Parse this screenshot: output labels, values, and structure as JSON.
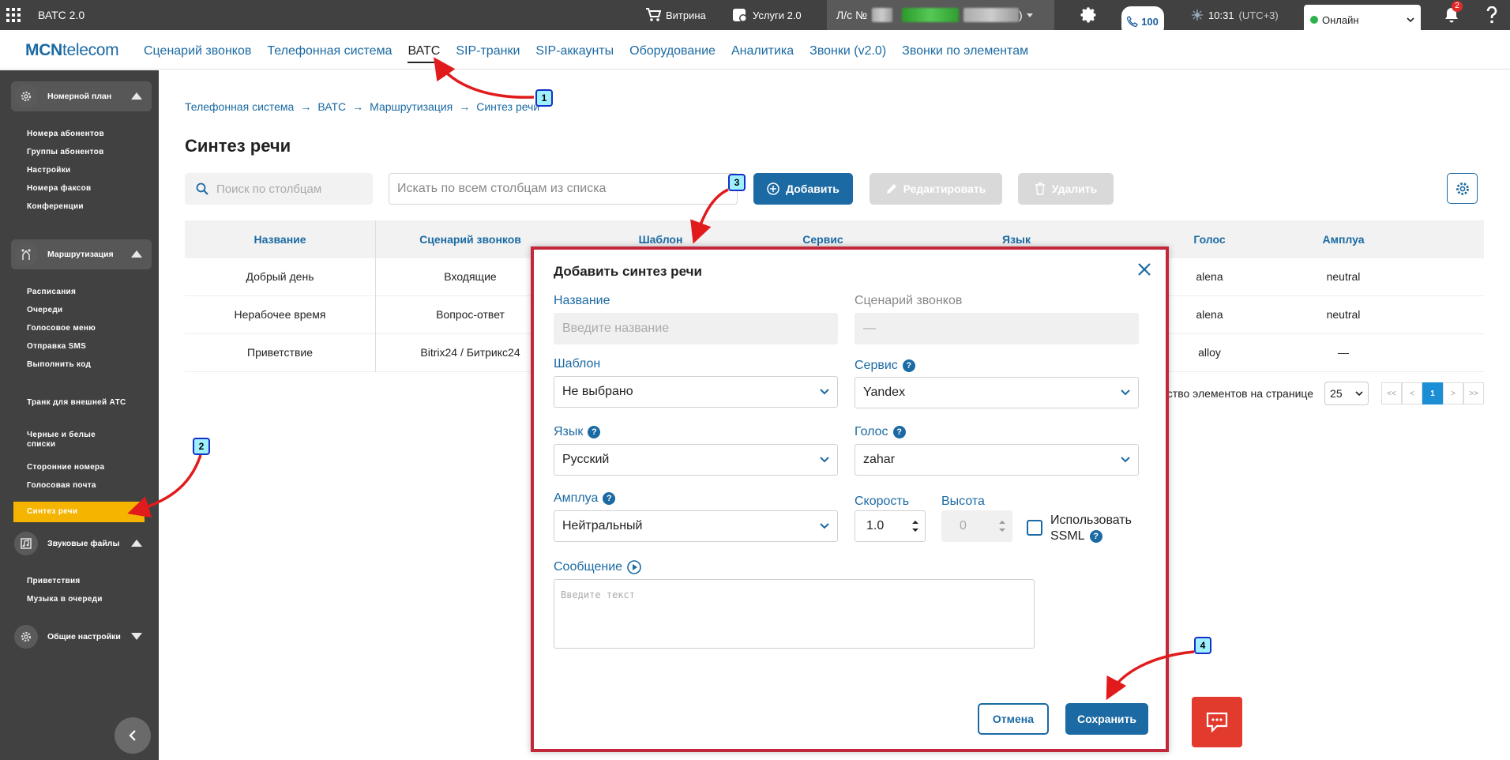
{
  "topbar": {
    "app_name": "ВАТС 2.0",
    "vitrina": "Витрина",
    "uslugi": "Услуги 2.0",
    "account_prefix": "Л/с №",
    "account_suffix": ")",
    "balance": "100",
    "time": "10:31",
    "timezone": "(UTC+3)",
    "status": "Онлайн",
    "notifications": "2"
  },
  "nav": {
    "logo_bold": "MCN",
    "logo_rest": "telecom",
    "links": [
      "Сценарий звонков",
      "Телефонная система",
      "ВАТС",
      "SIP-транки",
      "SIP-аккаунты",
      "Оборудование",
      "Аналитика",
      "Звонки (v2.0)",
      "Звонки по элементам"
    ],
    "active_index": 2
  },
  "sidebar": {
    "group1": {
      "label": "Номерной план",
      "items": [
        "Номера абонентов",
        "Группы абонентов",
        "Настройки",
        "Номера факсов",
        "Конференции"
      ]
    },
    "group2": {
      "label": "Маршрутизация",
      "items": [
        "Расписания",
        "Очереди",
        "Голосовое меню",
        "Отправка SMS",
        "Выполнить код",
        "Транк для внешней АТС",
        "Черные и белые списки",
        "Сторонние номера",
        "Голосовая почта",
        "Синтез речи"
      ]
    },
    "group3": {
      "label": "Звуковые файлы",
      "items": [
        "Приветствия",
        "Музыка в очереди"
      ]
    },
    "group4": {
      "label": "Общие настройки"
    }
  },
  "breadcrumb": [
    "Телефонная система",
    "ВАТС",
    "Маршрутизация",
    "Синтез речи"
  ],
  "page_title": "Синтез речи",
  "toolbar": {
    "col_search_placeholder": "Поиск по столбцам",
    "all_search_placeholder": "Искать по всем столбцам из списка",
    "add": "Добавить",
    "edit": "Редактировать",
    "delete": "Удалить"
  },
  "table": {
    "headers": [
      "Название",
      "Сценарий звонков",
      "Шаблон",
      "Сервис",
      "Язык",
      "Голос",
      "Амплуа"
    ],
    "rows": [
      [
        "Добрый день",
        "Входящие",
        "",
        "",
        "",
        "alena",
        "neutral"
      ],
      [
        "Нерабочее время",
        "Вопрос-ответ",
        "",
        "",
        "",
        "alena",
        "neutral"
      ],
      [
        "Приветствие",
        "Bitrix24 / Битрикс24",
        "",
        "",
        "",
        "alloy",
        "—"
      ]
    ]
  },
  "pager": {
    "label_tail": "ество элементов на странице",
    "per_page": "25",
    "first": "<<",
    "prev": "<",
    "current": "1",
    "next": ">",
    "last": ">>"
  },
  "modal": {
    "title": "Добавить синтез речи",
    "name_label": "Название",
    "name_placeholder": "Введите название",
    "scenario_label": "Сценарий звонков",
    "scenario_value": "—",
    "template_label": "Шаблон",
    "template_value": "Не выбрано",
    "service_label": "Сервис",
    "service_value": "Yandex",
    "language_label": "Язык",
    "language_value": "Русский",
    "voice_label": "Голос",
    "voice_value": "zahar",
    "role_label": "Амплуа",
    "role_value": "Нейтральный",
    "speed_label": "Скорость",
    "speed_value": "1.0",
    "height_label": "Высота",
    "height_value": "0",
    "ssml_label_1": "Использовать",
    "ssml_label_2": "SSML",
    "message_label": "Сообщение",
    "message_placeholder": "Введите текст",
    "cancel": "Отмена",
    "save": "Сохранить",
    "hint_glyph": "?"
  },
  "callouts": [
    "1",
    "2",
    "3",
    "4"
  ],
  "colors": {
    "primary": "#1b6aa3",
    "active_item": "#f5b400",
    "highlight_border": "#c2273a",
    "arrow": "#e11b1b",
    "chat": "#e33a2e"
  }
}
